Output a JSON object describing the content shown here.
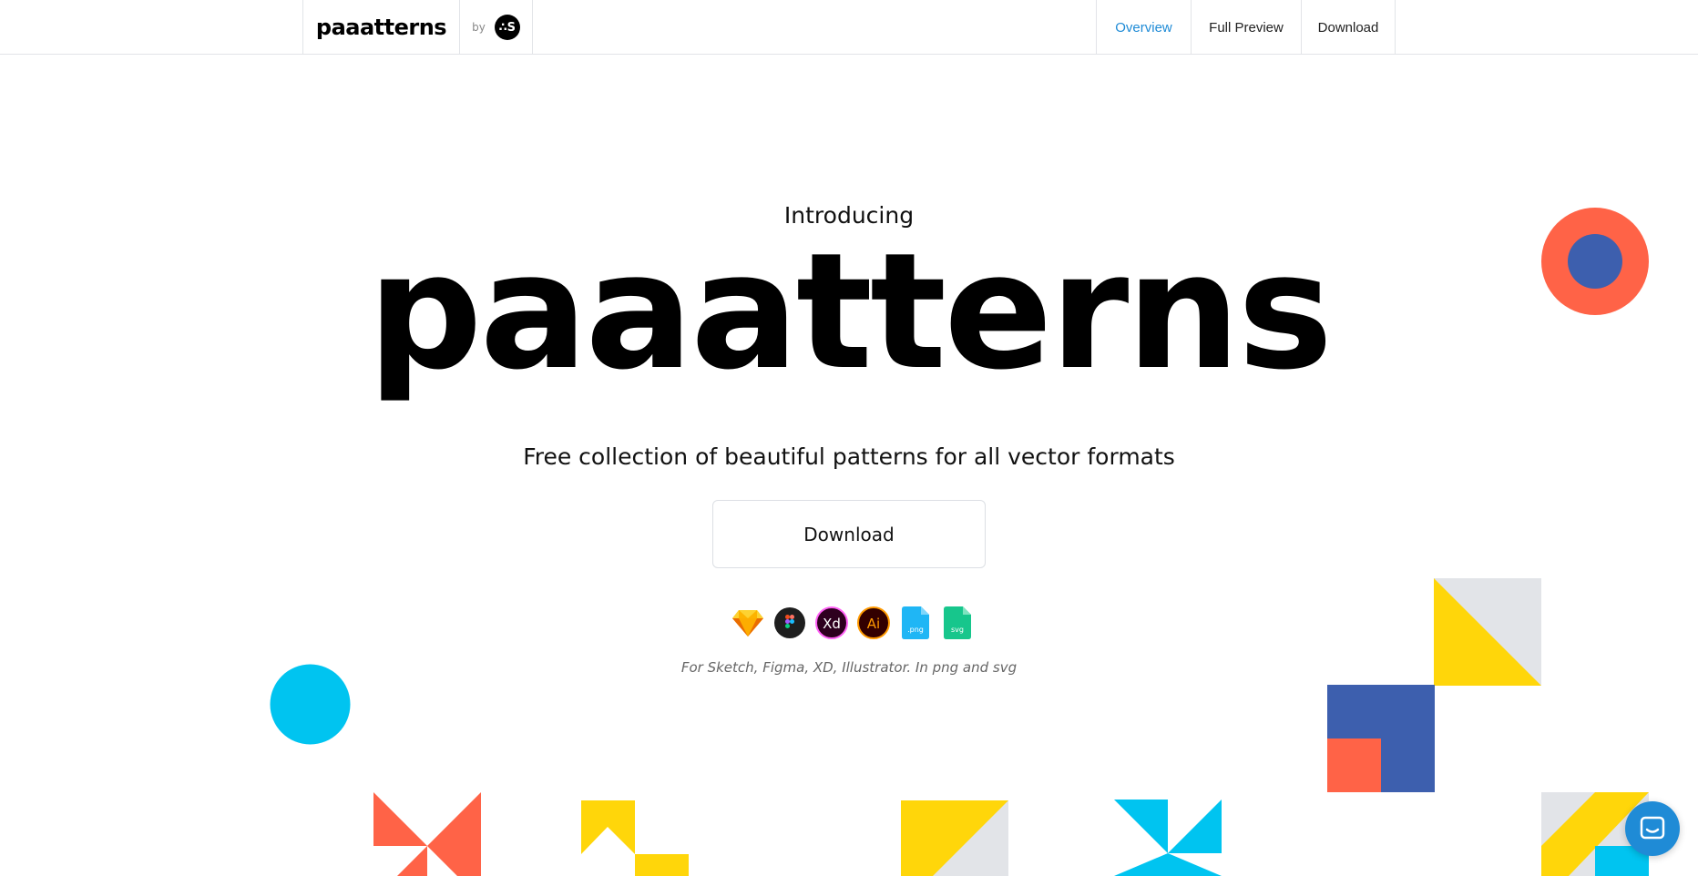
{
  "header": {
    "brand": "paaatterns",
    "by_label": "by",
    "by_logo_text": "∴S",
    "nav": [
      {
        "label": "Overview",
        "active": true
      },
      {
        "label": "Full Preview",
        "active": false
      },
      {
        "label": "Download",
        "active": false
      }
    ]
  },
  "hero": {
    "intro": "Introducing",
    "title": "paaatterns",
    "subtitle": "Free collection of beautiful patterns for all vector formats",
    "download_label": "Download",
    "formats": [
      {
        "name": "sketch-icon"
      },
      {
        "name": "figma-icon"
      },
      {
        "name": "xd-icon",
        "text": "Xd"
      },
      {
        "name": "illustrator-icon",
        "text": "Ai"
      },
      {
        "name": "png-file-icon",
        "text": ".png"
      },
      {
        "name": "svg-file-icon",
        "text": "svg"
      }
    ],
    "caption": "For Sketch, Figma, XD, Illustrator. In png and svg"
  },
  "colors": {
    "accent_blue": "#1f8bd6",
    "orange": "#ff6347",
    "navy": "#3d5fae",
    "yellow": "#ffd60a",
    "cyan": "#00c4f0",
    "gray": "#e2e4e8"
  },
  "chat_widget": {
    "icon": "chat-icon"
  }
}
